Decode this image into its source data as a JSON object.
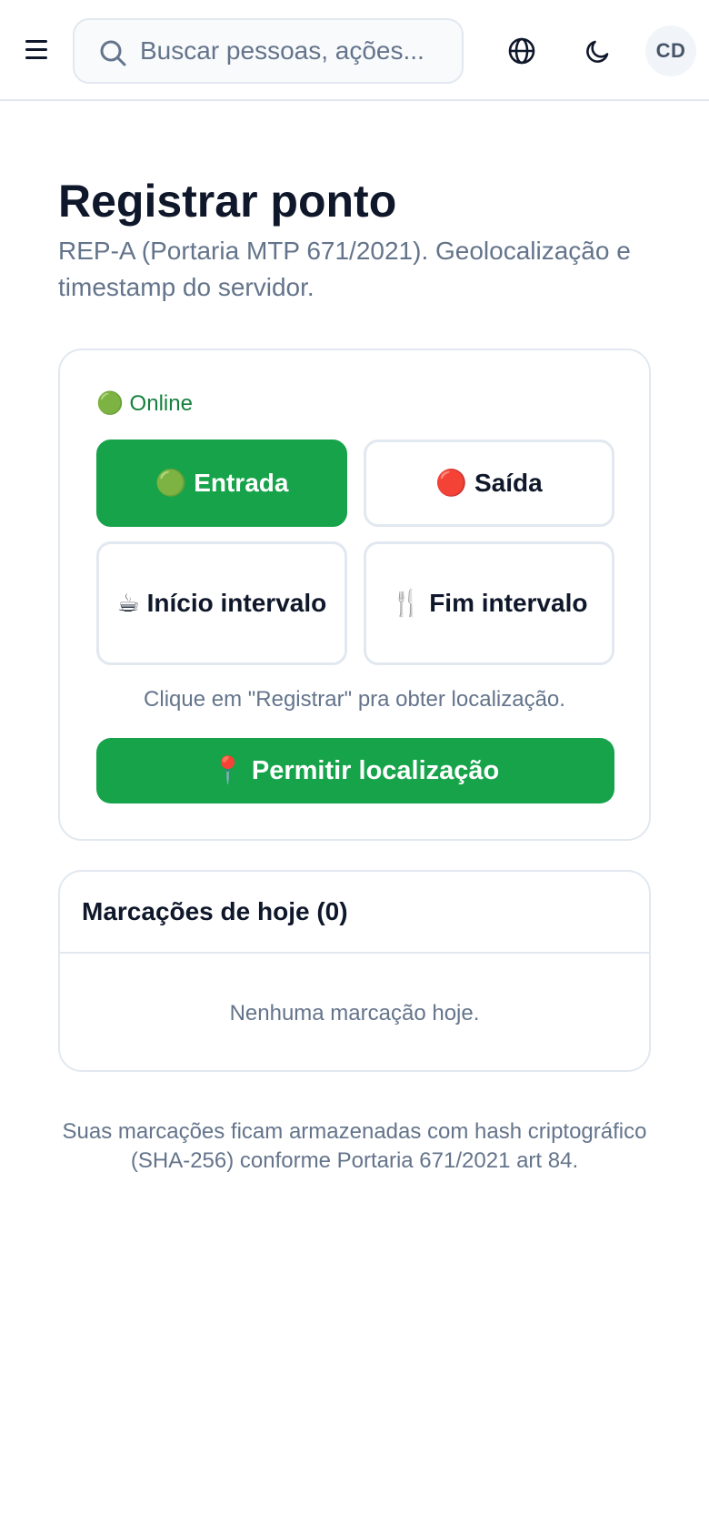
{
  "header": {
    "search_placeholder": "Buscar pessoas, ações...",
    "avatar_initials": "CD",
    "icons": [
      "menu-icon",
      "search-icon",
      "globe-icon",
      "moon-icon"
    ]
  },
  "page": {
    "title": "Registrar ponto",
    "subtitle": "REP-A (Portaria MTP 671/2021). Geolocalização e timestamp do servidor."
  },
  "punch": {
    "status": "🟢 Online",
    "actions": [
      {
        "label": "🟢 Entrada",
        "style": "primary"
      },
      {
        "label": "🔴 Saída",
        "style": "outline"
      },
      {
        "label": "☕ Início intervalo",
        "style": "outline"
      },
      {
        "label": "🍴 Fim intervalo",
        "style": "outline"
      }
    ],
    "hint": "Clique em \"Registrar\" pra obter localização.",
    "locate_label": "📍 Permitir localização"
  },
  "today": {
    "title": "Marcações de hoje (0)",
    "empty": "Nenhuma marcação hoje."
  },
  "footnote": "Suas marcações ficam armazenadas com hash criptográfico (SHA-256) conforme Portaria 671/2021 art 84.",
  "colors": {
    "primary": "#16a34a",
    "online": "#15803d",
    "muted": "#64748b",
    "border": "#e2e8f0",
    "text": "#0f172a"
  }
}
